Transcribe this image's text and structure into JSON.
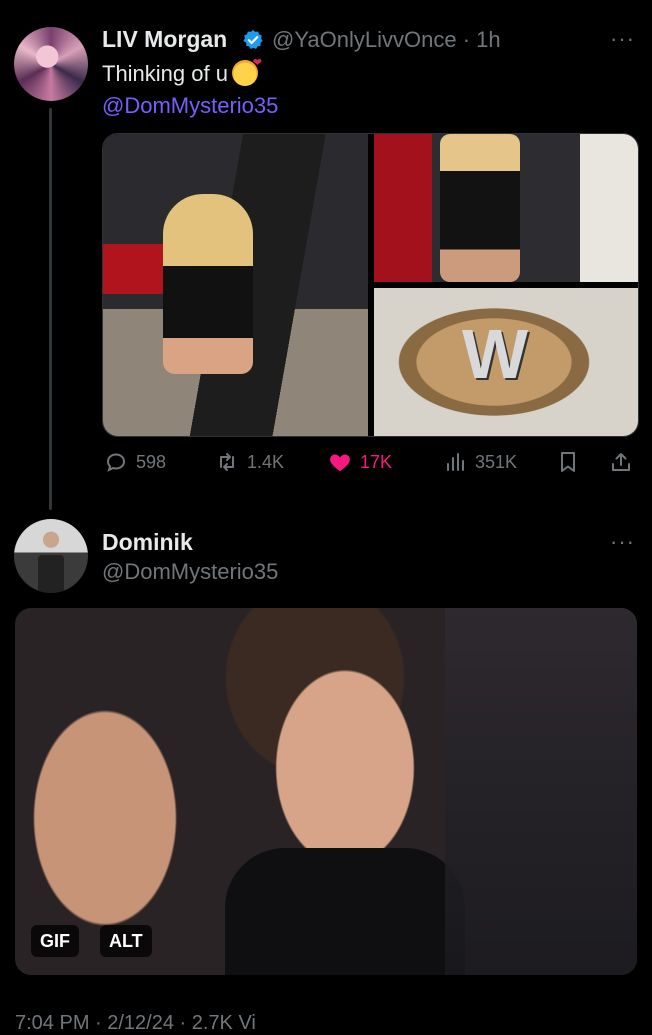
{
  "tweet1": {
    "display_name": "LIV Morgan",
    "handle": "@YaOnlyLivvOnce",
    "separator": "·",
    "time": "1h",
    "more": "···",
    "text": "Thinking of u",
    "mention": "@DomMysterio35",
    "actions": {
      "replies": "598",
      "retweets": "1.4K",
      "likes": "17K",
      "views": "351K"
    }
  },
  "tweet2": {
    "display_name": "Dominik",
    "handle": "@DomMysterio35",
    "more": "···",
    "media_badges": [
      "GIF",
      "ALT"
    ]
  },
  "footer": {
    "partial_text": "7:04 PM · 2/12/24 · 2.7K Vi"
  },
  "colors": {
    "background": "#000000",
    "text": "#e7e9ea",
    "secondary": "#71767b",
    "mention": "#7a5cff",
    "like": "#f91880",
    "verified": "#1d9bf0"
  }
}
